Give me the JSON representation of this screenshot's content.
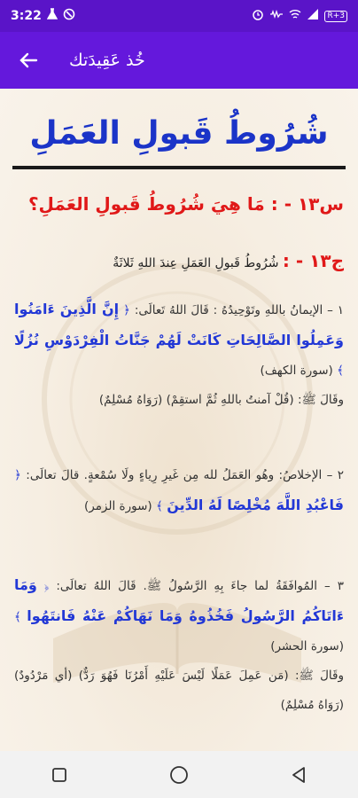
{
  "status": {
    "time": "3:22",
    "badge": "R+3"
  },
  "app_bar": {
    "title": "خُذ عَقِيدَتك"
  },
  "heading": "شُرُوطُ قَبولِ العَمَلِ",
  "question": "س١٣ - : مَا هِيَ شُرُوطُ قَبولِ العَمَلِ؟",
  "answer": {
    "label": "ج١٣ - :",
    "text": "شُرُوطُ قَبولِ العَمَلِ عِندَ اللهِ ثَلاثَةٌ"
  },
  "cond1": {
    "intro": "١ – الإيمانُ باللهِ وتَوْحِيدُهُ : قَالَ اللهُ تَعالَى:",
    "verse": "إِنَّ الَّذِينَ ءَامَنُوا وَعَمِلُوا الصَّالِحَاتِ كَانَتْ لَهُمْ جَنَّاتُ الْفِرْدَوْسِ نُزُلًا",
    "ref": "(سورة الكهف)",
    "hadith_intro": "وقَالَ ﷺ:",
    "hadith": "(قُلْ آمنتُ باللهِ ثُمَّ استقِمْ) (رَوَاهُ مُسْلِمٌ)"
  },
  "cond2": {
    "intro": "٢ – الإخلاصُ: وهُو العَمَلُ لله مِن غَيرِ رِياءٍ ولَا سُمْعةٍ. قالَ تعالَى:",
    "verse": "فَاعْبُدِ اللَّهَ مُخْلِصًا لَهُ الدِّينَ",
    "ref": "(سورة الزمر)"
  },
  "cond3": {
    "intro": "٣ – المُوافَقَةُ لما جاءَ بِهِ الرَّسُولُ ﷺ. قَالَ اللهُ تعالَى:",
    "verse": "وَمَا ءَاتَاكُمُ الرَّسُولُ فَخُذُوهُ وَمَا نَهَاكُمْ عَنْهُ فَانتَهُوا",
    "ref": "(سورة الحشر)",
    "hadith_intro": "وقَالَ ﷺ:",
    "hadith": "(مَن عَمِلَ عَمَلًا لَيْسَ عَلَيْهِ أَمْرُنَا فَهُوَ رَدٌّ) (أي مَرْدُودٌ) (رَوَاهُ مُسْلِمٌ)"
  },
  "colors": {
    "primary": "#6418dc",
    "heading": "#1b34c8",
    "red": "#e01818",
    "verse": "#2238d6"
  },
  "icons": [
    "back-arrow-icon",
    "recents-square-icon",
    "home-circle-icon",
    "back-triangle-icon"
  ]
}
